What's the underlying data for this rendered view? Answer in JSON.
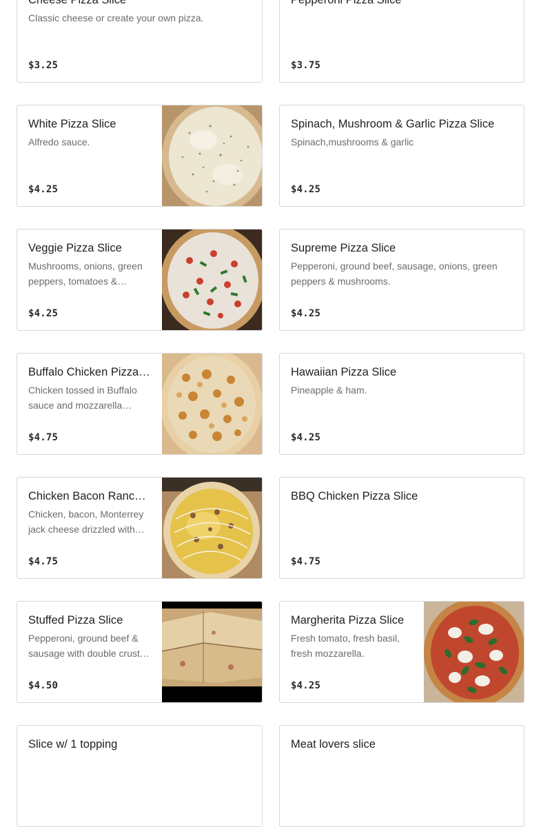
{
  "menu": {
    "items": [
      {
        "name": "Cheese Pizza Slice",
        "description": "Classic cheese or create your own pizza.",
        "price": "$3.25",
        "image": null
      },
      {
        "name": "Pepperoni Pizza Slice",
        "description": "",
        "price": "$3.75",
        "image": null
      },
      {
        "name": "White Pizza Slice",
        "description": "Alfredo sauce.",
        "price": "$4.25",
        "image": "white-pizza-photo"
      },
      {
        "name": "Spinach, Mushroom & Garlic Pizza Slice",
        "description": "Spinach,mushrooms & garlic",
        "price": "$4.25",
        "image": null
      },
      {
        "name": "Veggie Pizza Slice",
        "description": "Mushrooms, onions, green peppers, tomatoes & mushrooms.",
        "price": "$4.25",
        "image": "veggie-pizza-photo"
      },
      {
        "name": "Supreme Pizza Slice",
        "description": "Pepperoni, ground beef, sausage, onions, green peppers & mushrooms.",
        "price": "$4.25",
        "image": null
      },
      {
        "name": "Buffalo Chicken Pizza Slice",
        "description": "Chicken tossed in Buffalo sauce and mozzarella cheese.",
        "price": "$4.75",
        "image": "buffalo-chicken-pizza-photo"
      },
      {
        "name": "Hawaiian Pizza Slice",
        "description": "Pineapple & ham.",
        "price": "$4.25",
        "image": null
      },
      {
        "name": "Chicken Bacon Ranch Pizza Slice",
        "description": "Chicken, bacon, Monterrey jack cheese drizzled with ranch.",
        "price": "$4.75",
        "image": "chicken-bacon-ranch-pizza-photo"
      },
      {
        "name": "BBQ Chicken Pizza Slice",
        "description": "",
        "price": "$4.75",
        "image": null
      },
      {
        "name": "Stuffed Pizza Slice",
        "description": "Pepperoni, ground beef & sausage with double crust on top.",
        "price": "$4.50",
        "image": "stuffed-pizza-photo"
      },
      {
        "name": "Margherita Pizza Slice",
        "description": "Fresh tomato, fresh basil, fresh mozzarella.",
        "price": "$4.25",
        "image": "margherita-pizza-photo"
      },
      {
        "name": "Slice w/ 1 topping",
        "description": "",
        "price": "",
        "image": null
      },
      {
        "name": "Meat lovers slice",
        "description": "",
        "price": "",
        "image": null
      }
    ]
  }
}
